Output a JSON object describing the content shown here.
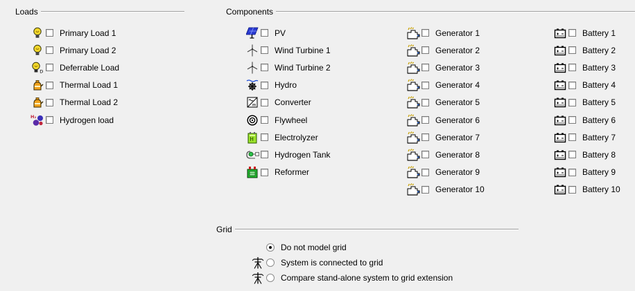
{
  "loads": {
    "title": "Loads",
    "items": [
      {
        "label": "Primary Load 1",
        "icon": "bulb-icon"
      },
      {
        "label": "Primary Load 2",
        "icon": "bulb-icon"
      },
      {
        "label": "Deferrable Load",
        "icon": "deferrable-bulb-icon"
      },
      {
        "label": "Thermal Load 1",
        "icon": "kettle-icon"
      },
      {
        "label": "Thermal Load 2",
        "icon": "kettle-icon"
      },
      {
        "label": "Hydrogen load",
        "icon": "hydrogen-molecule-icon"
      }
    ]
  },
  "components": {
    "title": "Components",
    "main": [
      {
        "label": "PV",
        "icon": "pv-panel-icon"
      },
      {
        "label": "Wind Turbine 1",
        "icon": "wind-turbine-icon"
      },
      {
        "label": "Wind Turbine 2",
        "icon": "wind-turbine-icon"
      },
      {
        "label": "Hydro",
        "icon": "hydro-turbine-icon"
      },
      {
        "label": "Converter",
        "icon": "converter-icon"
      },
      {
        "label": "Flywheel",
        "icon": "flywheel-icon"
      },
      {
        "label": "Electrolyzer",
        "icon": "electrolyzer-icon"
      },
      {
        "label": "Hydrogen Tank",
        "icon": "hydrogen-tank-icon"
      },
      {
        "label": "Reformer",
        "icon": "reformer-icon"
      }
    ],
    "generators": [
      "Generator 1",
      "Generator 2",
      "Generator 3",
      "Generator 4",
      "Generator 5",
      "Generator 6",
      "Generator 7",
      "Generator 8",
      "Generator 9",
      "Generator 10"
    ],
    "batteries": [
      "Battery 1",
      "Battery 2",
      "Battery 3",
      "Battery 4",
      "Battery 5",
      "Battery 6",
      "Battery 7",
      "Battery 8",
      "Battery 9",
      "Battery 10"
    ]
  },
  "grid": {
    "title": "Grid",
    "options": [
      {
        "label": "Do not model grid",
        "checked": true,
        "icon": ""
      },
      {
        "label": "System is connected to grid",
        "checked": false,
        "icon": "grid-tower-icon"
      },
      {
        "label": "Compare stand-alone system to grid extension",
        "checked": false,
        "icon": "grid-tower-icon"
      }
    ]
  }
}
